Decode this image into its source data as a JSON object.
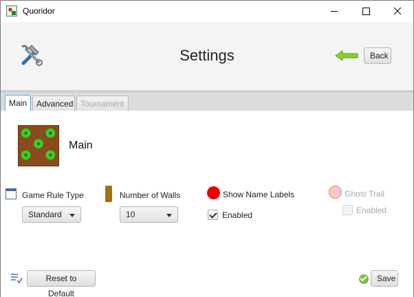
{
  "window": {
    "title": "Quoridor"
  },
  "header": {
    "title": "Settings",
    "back_label": "Back",
    "tools_icon": "hammer-wrench-icon",
    "back_icon": "green-left-arrow-icon"
  },
  "tabs": [
    {
      "label": "Main",
      "selected": true,
      "enabled": true
    },
    {
      "label": "Advanced",
      "selected": false,
      "enabled": true
    },
    {
      "label": "Tournament",
      "selected": false,
      "enabled": false
    }
  ],
  "main": {
    "section_title": "Main",
    "game_rule": {
      "label": "Game Rule Type",
      "value": "Standard"
    },
    "walls": {
      "label": "Number of Walls",
      "value": "10",
      "icon_color": "#a0701a"
    },
    "name_labels": {
      "label": "Show Name Labels",
      "checkbox_label": "Enabled",
      "checked": true,
      "icon_color": "#ee0000"
    },
    "ghost_trail": {
      "label": "Ghost Trail",
      "checkbox_label": "Enabled",
      "checked": false,
      "enabled": false
    }
  },
  "footer": {
    "reset_label": "Reset to Default",
    "save_label": "Save"
  },
  "colors": {
    "accent_tab": "#5aa9e0",
    "save_icon": "#7bc043",
    "disabled_text": "#a8a8a8"
  }
}
